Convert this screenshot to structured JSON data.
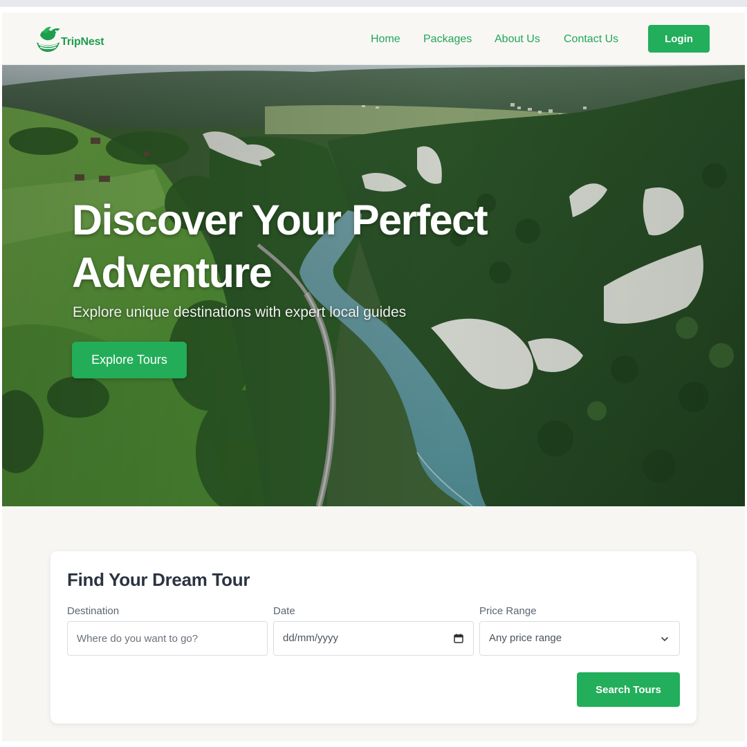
{
  "colors": {
    "brand_green": "#22ae5a",
    "nav_link": "#22a559",
    "heading_dark": "#2b3440",
    "page_bg": "#f7f6f3"
  },
  "header": {
    "logo_text": "TripNest",
    "logo_icon": "bird-nest-logo-icon",
    "nav": [
      {
        "label": "Home"
      },
      {
        "label": "Packages"
      },
      {
        "label": "About Us"
      },
      {
        "label": "Contact Us"
      }
    ],
    "login_label": "Login"
  },
  "hero": {
    "title": "Discover Your Perfect Adventure",
    "subtitle": "Explore unique destinations with expert local guides",
    "cta_label": "Explore Tours",
    "background": "aerial photo of a river valley with forested slopes"
  },
  "search": {
    "title": "Find Your Dream Tour",
    "destination_label": "Destination",
    "destination_placeholder": "Where do you want to go?",
    "date_label": "Date",
    "date_value": "dd/mm/yyyy",
    "date_icon": "calendar-icon",
    "price_label": "Price Range",
    "price_selected": "Any price range",
    "price_icon": "chevron-down-icon",
    "submit_label": "Search Tours"
  }
}
